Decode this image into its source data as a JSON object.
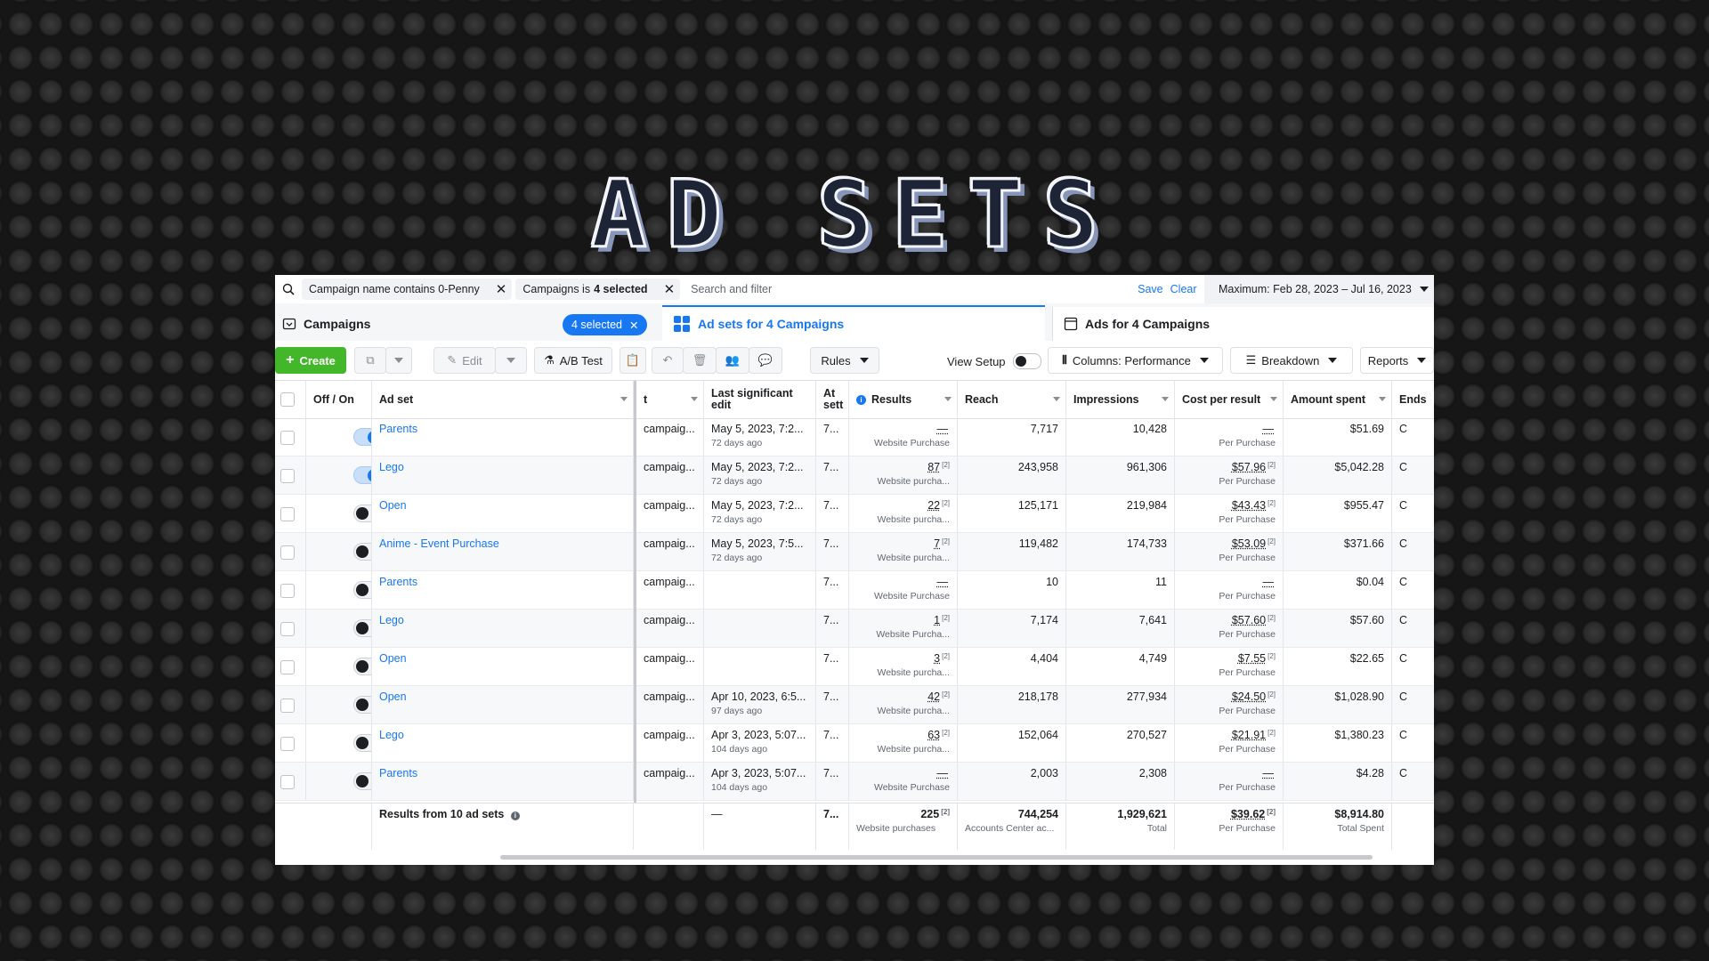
{
  "banner": {
    "title": "AD SETS"
  },
  "filters": {
    "chip1_text": "Campaign name contains 0-Penny",
    "chip2_prefix": "Campaigns is",
    "chip2_value": "4 selected",
    "search_placeholder": "Search and filter",
    "save_label": "Save",
    "clear_label": "Clear",
    "date_range": "Maximum: Feb 28, 2023 – Jul 16, 2023"
  },
  "tabs": {
    "campaigns": "Campaigns",
    "selected_badge": "4 selected",
    "adsets": "Ad sets for 4 Campaigns",
    "ads": "Ads for 4 Campaigns"
  },
  "toolbar": {
    "create": "Create",
    "edit": "Edit",
    "ab_test": "A/B Test",
    "rules": "Rules",
    "view_setup": "View Setup",
    "columns": "Columns: Performance",
    "breakdown": "Breakdown",
    "reports": "Reports"
  },
  "columns": {
    "offon": "Off / On",
    "adset": "Ad set",
    "t": "t",
    "last_edit_1": "Last significant",
    "last_edit_2": "edit",
    "att_1": "At",
    "att_2": "sett",
    "results": "Results",
    "reach": "Reach",
    "impressions": "Impressions",
    "cost": "Cost per result",
    "amount": "Amount spent",
    "ends": "Ends"
  },
  "rows": [
    {
      "on": true,
      "name": "Parents",
      "campaign": "campaig...",
      "edit": "May 5, 2023, 7:2...",
      "edit_sub": "72 days ago",
      "att": "7...",
      "results": "—",
      "results_sup": "",
      "results_sub": "Website Purchase",
      "reach": "7,717",
      "impressions": "10,428",
      "cost": "—",
      "cost_sup": "",
      "cost_sub": "Per Purchase",
      "amount": "$51.69",
      "ends": "C"
    },
    {
      "on": true,
      "name": "Lego",
      "campaign": "campaig...",
      "edit": "May 5, 2023, 7:2...",
      "edit_sub": "72 days ago",
      "att": "7...",
      "results": "87",
      "results_sup": "[2]",
      "results_sub": "Website purcha...",
      "reach": "243,958",
      "impressions": "961,306",
      "cost": "$57.96",
      "cost_sup": "[2]",
      "cost_sub": "Per Purchase",
      "amount": "$5,042.28",
      "ends": "C"
    },
    {
      "on": false,
      "name": "Open",
      "campaign": "campaig...",
      "edit": "May 5, 2023, 7:2...",
      "edit_sub": "72 days ago",
      "att": "7...",
      "results": "22",
      "results_sup": "[2]",
      "results_sub": "Website purcha...",
      "reach": "125,171",
      "impressions": "219,984",
      "cost": "$43.43",
      "cost_sup": "[2]",
      "cost_sub": "Per Purchase",
      "amount": "$955.47",
      "ends": "C"
    },
    {
      "on": false,
      "name": "Anime - Event Purchase",
      "campaign": "campaig...",
      "edit": "May 5, 2023, 7:5...",
      "edit_sub": "72 days ago",
      "att": "7...",
      "results": "7",
      "results_sup": "[2]",
      "results_sub": "Website purcha...",
      "reach": "119,482",
      "impressions": "174,733",
      "cost": "$53.09",
      "cost_sup": "[2]",
      "cost_sub": "Per Purchase",
      "amount": "$371.66",
      "ends": "C"
    },
    {
      "on": false,
      "name": "Parents",
      "campaign": "campaig...",
      "edit": "",
      "edit_sub": "",
      "att": "7...",
      "results": "—",
      "results_sup": "",
      "results_sub": "Website Purchase",
      "reach": "10",
      "impressions": "11",
      "cost": "—",
      "cost_sup": "",
      "cost_sub": "Per Purchase",
      "amount": "$0.04",
      "ends": "C"
    },
    {
      "on": false,
      "name": "Lego",
      "campaign": "campaig...",
      "edit": "",
      "edit_sub": "",
      "att": "7...",
      "results": "1",
      "results_sup": "[2]",
      "results_sub": "Website Purcha...",
      "reach": "7,174",
      "impressions": "7,641",
      "cost": "$57.60",
      "cost_sup": "[2]",
      "cost_sub": "Per Purchase",
      "amount": "$57.60",
      "ends": "C"
    },
    {
      "on": false,
      "name": "Open",
      "campaign": "campaig...",
      "edit": "",
      "edit_sub": "",
      "att": "7...",
      "results": "3",
      "results_sup": "[2]",
      "results_sub": "Website purcha...",
      "reach": "4,404",
      "impressions": "4,749",
      "cost": "$7.55",
      "cost_sup": "[2]",
      "cost_sub": "Per Purchase",
      "amount": "$22.65",
      "ends": "C"
    },
    {
      "on": false,
      "name": "Open",
      "campaign": "campaig...",
      "edit": "Apr 10, 2023, 6:5...",
      "edit_sub": "97 days ago",
      "att": "7...",
      "results": "42",
      "results_sup": "[2]",
      "results_sub": "Website purcha...",
      "reach": "218,178",
      "impressions": "277,934",
      "cost": "$24.50",
      "cost_sup": "[2]",
      "cost_sub": "Per Purchase",
      "amount": "$1,028.90",
      "ends": "C"
    },
    {
      "on": false,
      "name": "Lego",
      "campaign": "campaig...",
      "edit": "Apr 3, 2023, 5:07...",
      "edit_sub": "104 days ago",
      "att": "7...",
      "results": "63",
      "results_sup": "[2]",
      "results_sub": "Website purcha...",
      "reach": "152,064",
      "impressions": "270,527",
      "cost": "$21.91",
      "cost_sup": "[2]",
      "cost_sub": "Per Purchase",
      "amount": "$1,380.23",
      "ends": "C"
    },
    {
      "on": false,
      "name": "Parents",
      "campaign": "campaig...",
      "edit": "Apr 3, 2023, 5:07...",
      "edit_sub": "104 days ago",
      "att": "7...",
      "results": "—",
      "results_sup": "",
      "results_sub": "Website Purchase",
      "reach": "2,003",
      "impressions": "2,308",
      "cost": "—",
      "cost_sup": "",
      "cost_sub": "Per Purchase",
      "amount": "$4.28",
      "ends": "C"
    }
  ],
  "totals": {
    "label": "Results from 10 ad sets",
    "edit": "—",
    "att": "7...",
    "results": "225",
    "results_sup": "[2]",
    "results_sub": "Website purchases",
    "reach": "744,254",
    "reach_sub": "Accounts Center ac...",
    "impressions": "1,929,621",
    "impressions_sub": "Total",
    "cost": "$39.62",
    "cost_sup": "[2]",
    "cost_sub": "Per Purchase",
    "amount": "$8,914.80",
    "amount_sub": "Total Spent"
  },
  "colors": {
    "accent": "#1877f2",
    "create": "#42b72a"
  }
}
